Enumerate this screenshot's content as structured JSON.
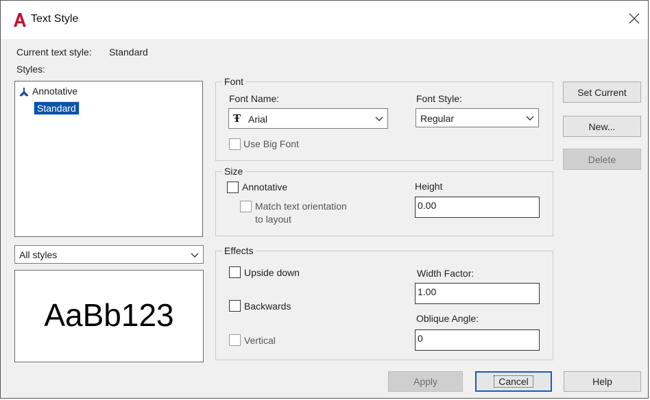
{
  "window": {
    "title": "Text Style",
    "close_symbol": "✕"
  },
  "current_style": {
    "label": "Current text style:",
    "value": "Standard"
  },
  "styles": {
    "label": "Styles:",
    "items": [
      {
        "label": "Annotative",
        "icon": "annotative-icon",
        "selected": false
      },
      {
        "label": "Standard",
        "selected": true
      }
    ],
    "filter_value": "All styles"
  },
  "preview": {
    "text": "AaBb123"
  },
  "font": {
    "group_label": "Font",
    "name_label": "Font Name:",
    "name_value": "Arial",
    "name_icon": "truetype-font-icon",
    "style_label": "Font Style:",
    "style_value": "Regular",
    "big_font_label": "Use Big Font",
    "big_font_checked": false
  },
  "size": {
    "group_label": "Size",
    "annotative_label": "Annotative",
    "annotative_checked": false,
    "match_label_line1": "Match text orientation",
    "match_label_line2": "to layout",
    "match_checked": false,
    "height_label": "Height",
    "height_value": "0.00"
  },
  "effects": {
    "group_label": "Effects",
    "upside_down_label": "Upside down",
    "upside_down_checked": false,
    "backwards_label": "Backwards",
    "backwards_checked": false,
    "vertical_label": "Vertical",
    "vertical_checked": false,
    "width_factor_label": "Width Factor:",
    "width_factor_value": "1.00",
    "oblique_label": "Oblique Angle:",
    "oblique_value": "0"
  },
  "buttons": {
    "set_current": "Set Current",
    "new": "New...",
    "delete": "Delete",
    "apply": "Apply",
    "cancel": "Cancel",
    "help": "Help"
  },
  "colors": {
    "accent_selection": "#0a53a8",
    "app_icon_red": "#c8102e",
    "annotative_icon_blue": "#1f4e96"
  }
}
